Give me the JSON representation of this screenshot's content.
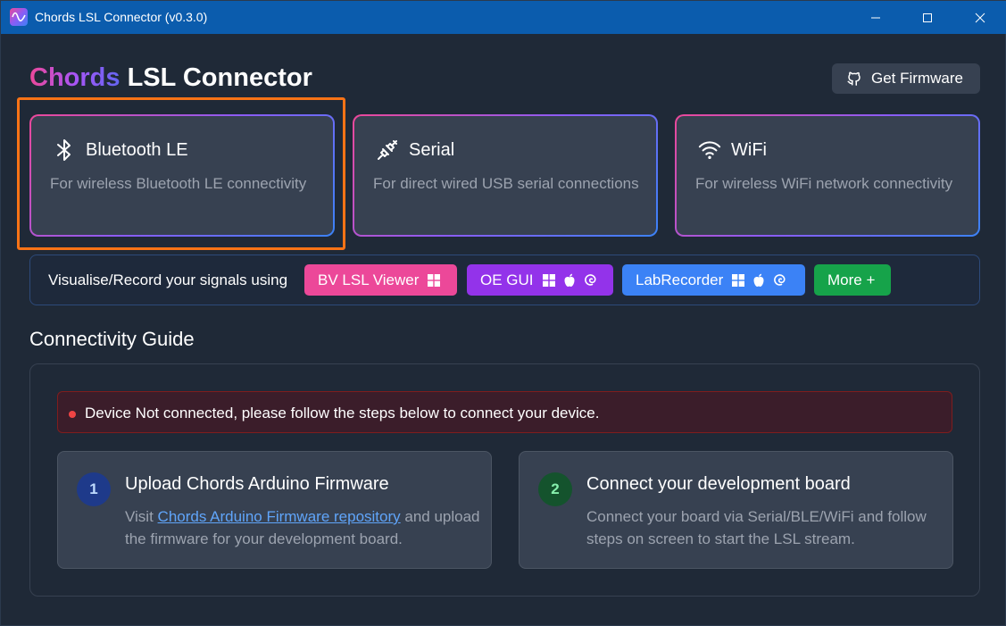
{
  "window": {
    "title": "Chords LSL Connector (v0.3.0)"
  },
  "header": {
    "brand_primary": "Chords",
    "brand_secondary": "LSL Connector",
    "firmware_button": "Get Firmware"
  },
  "connections": [
    {
      "title": "Bluetooth LE",
      "description": "For wireless Bluetooth LE connectivity",
      "icon": "bluetooth-icon"
    },
    {
      "title": "Serial",
      "description": "For direct wired USB serial connections",
      "icon": "usb-icon"
    },
    {
      "title": "WiFi",
      "description": "For wireless WiFi network connectivity",
      "icon": "wifi-icon"
    }
  ],
  "visualise": {
    "label": "Visualise/Record your signals using",
    "apps": [
      {
        "label": "BV LSL Viewer",
        "color": "#ec4899",
        "platforms": [
          "windows-icon"
        ]
      },
      {
        "label": "OE GUI",
        "color": "#9333ea",
        "platforms": [
          "windows-icon",
          "apple-icon",
          "debian-icon"
        ]
      },
      {
        "label": "LabRecorder",
        "color": "#3b82f6",
        "platforms": [
          "windows-icon",
          "apple-icon",
          "debian-icon"
        ]
      }
    ],
    "more": {
      "label": "More +",
      "color": "#16a34a"
    }
  },
  "guide": {
    "title": "Connectivity Guide",
    "alert": "Device Not connected, please follow the steps below to connect your device.",
    "steps": [
      {
        "number": "1",
        "title": "Upload Chords Arduino Firmware",
        "desc_prefix": "Visit ",
        "link": "Chords Arduino Firmware repository",
        "desc_suffix": " and upload the firmware for your development board."
      },
      {
        "number": "2",
        "title": "Connect your development board",
        "desc": "Connect your board via Serial/BLE/WiFi and follow steps on screen to start the LSL stream."
      }
    ]
  }
}
